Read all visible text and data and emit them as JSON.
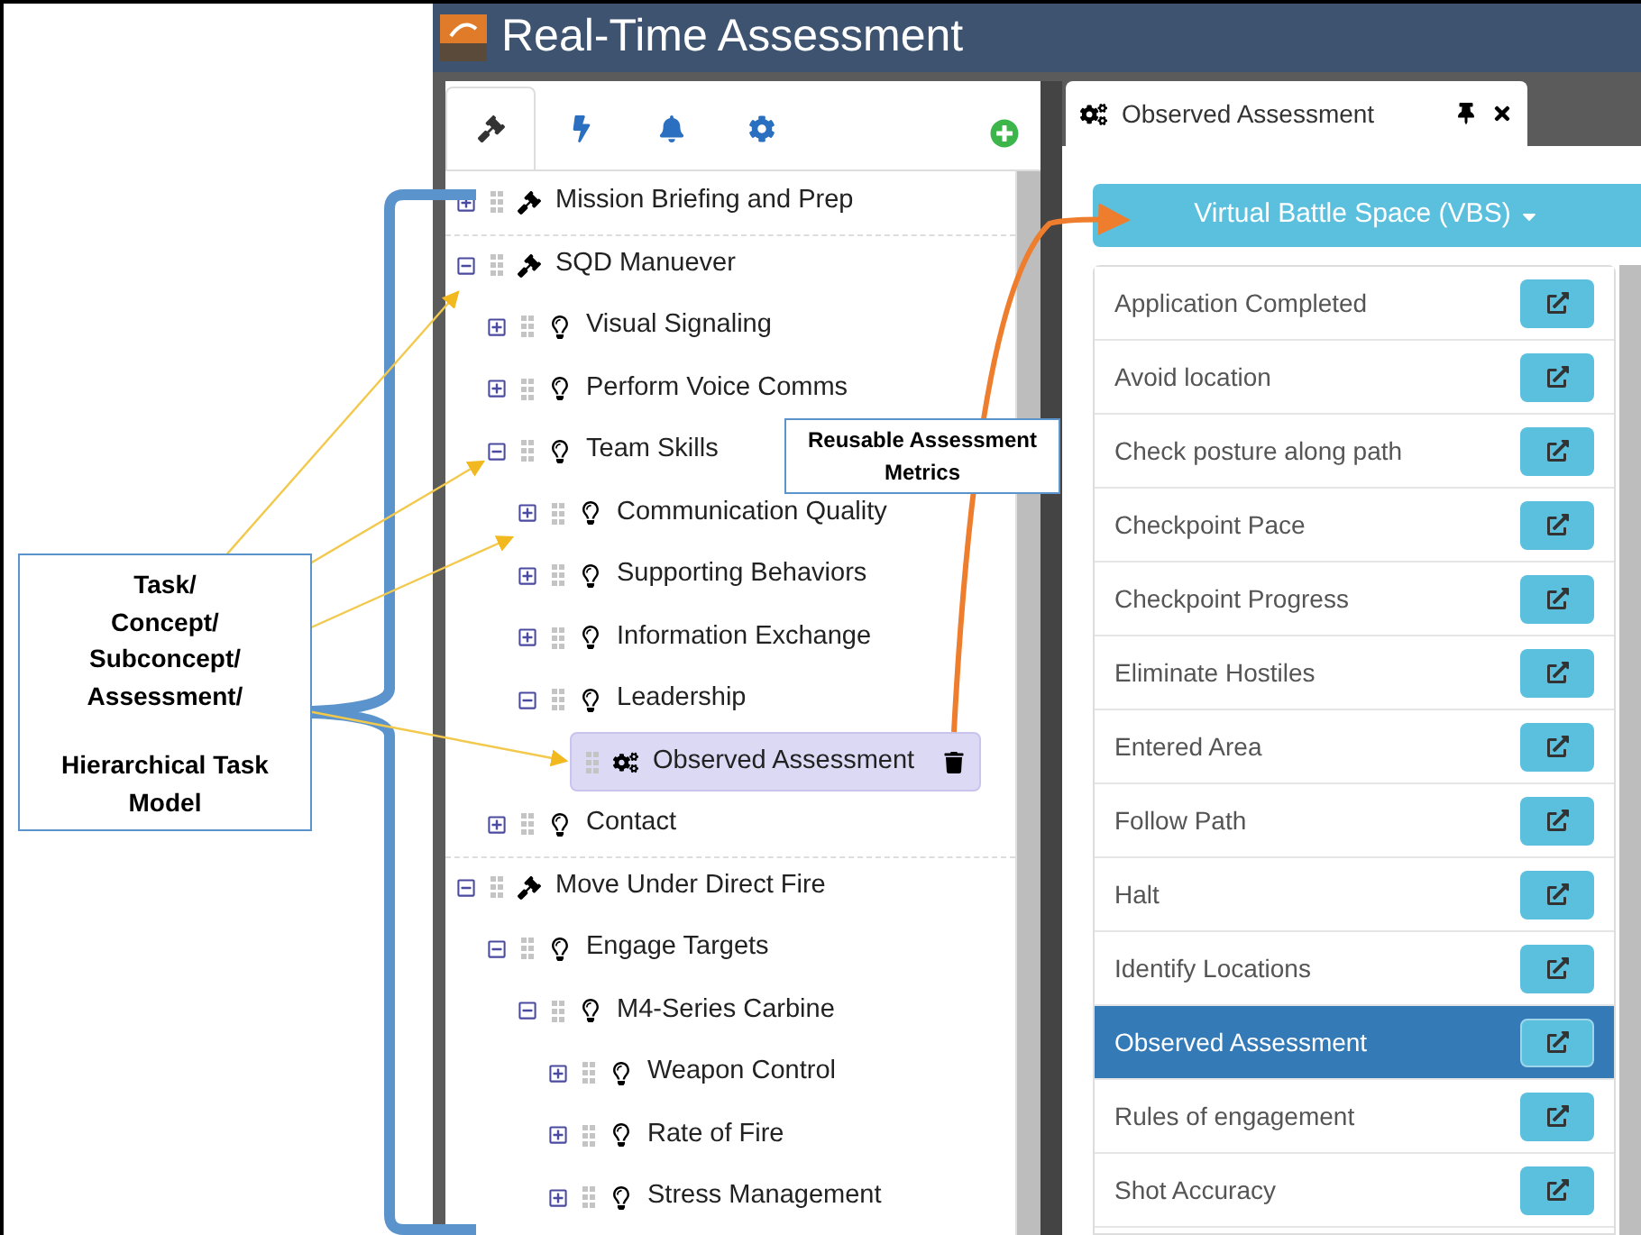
{
  "annotation": {
    "lines": [
      "Task/",
      "Concept/",
      "Subconcept/",
      "Assessment/"
    ],
    "footer": "Hierarchical Task Model",
    "callout": "Reusable Assessment Metrics"
  },
  "window": {
    "title": "Real-Time Assessment"
  },
  "tabs": [
    {
      "kind": "hammer",
      "selected": true
    },
    {
      "kind": "bolt",
      "selected": false
    },
    {
      "kind": "bell",
      "selected": false
    },
    {
      "kind": "gear",
      "selected": false
    }
  ],
  "tree": [
    {
      "label": "Mission Briefing and Prep",
      "kind": "task",
      "expanded": false
    },
    {
      "label": "SQD Manuever",
      "kind": "task",
      "expanded": true,
      "children": [
        {
          "label": "Visual Signaling",
          "kind": "concept",
          "expanded": false
        },
        {
          "label": "Perform Voice Comms",
          "kind": "concept",
          "expanded": false
        },
        {
          "label": "Team Skills",
          "kind": "concept",
          "expanded": true,
          "children": [
            {
              "label": "Communication Quality",
              "kind": "concept",
              "expanded": false
            },
            {
              "label": "Supporting Behaviors",
              "kind": "concept",
              "expanded": false
            },
            {
              "label": "Information Exchange",
              "kind": "concept",
              "expanded": false
            },
            {
              "label": "Leadership",
              "kind": "concept",
              "expanded": true,
              "children": [
                {
                  "label": "Observed Assessment",
                  "kind": "assessment",
                  "selected": true
                }
              ]
            }
          ]
        },
        {
          "label": "Contact",
          "kind": "concept",
          "expanded": false
        }
      ]
    },
    {
      "label": "Move Under Direct Fire",
      "kind": "task",
      "expanded": true,
      "children": [
        {
          "label": "Engage Targets",
          "kind": "concept",
          "expanded": true,
          "children": [
            {
              "label": "M4-Series Carbine",
              "kind": "concept",
              "expanded": true,
              "children": [
                {
                  "label": "Weapon Control",
                  "kind": "concept",
                  "expanded": false
                },
                {
                  "label": "Rate of Fire",
                  "kind": "concept",
                  "expanded": false
                },
                {
                  "label": "Stress Management",
                  "kind": "concept",
                  "expanded": false
                }
              ]
            }
          ]
        }
      ]
    }
  ],
  "panel": {
    "title": "Observed Assessment",
    "dropdown": "Virtual Battle Space (VBS)",
    "items": [
      {
        "label": "Application Completed",
        "selected": false
      },
      {
        "label": "Avoid location",
        "selected": false
      },
      {
        "label": "Check posture along path",
        "selected": false
      },
      {
        "label": "Checkpoint Pace",
        "selected": false
      },
      {
        "label": "Checkpoint Progress",
        "selected": false
      },
      {
        "label": "Eliminate Hostiles",
        "selected": false
      },
      {
        "label": "Entered Area",
        "selected": false
      },
      {
        "label": "Follow Path",
        "selected": false
      },
      {
        "label": "Halt",
        "selected": false
      },
      {
        "label": "Identify Locations",
        "selected": false
      },
      {
        "label": "Observed Assessment",
        "selected": true
      },
      {
        "label": "Rules of engagement",
        "selected": false
      },
      {
        "label": "Shot Accuracy",
        "selected": false
      }
    ]
  }
}
